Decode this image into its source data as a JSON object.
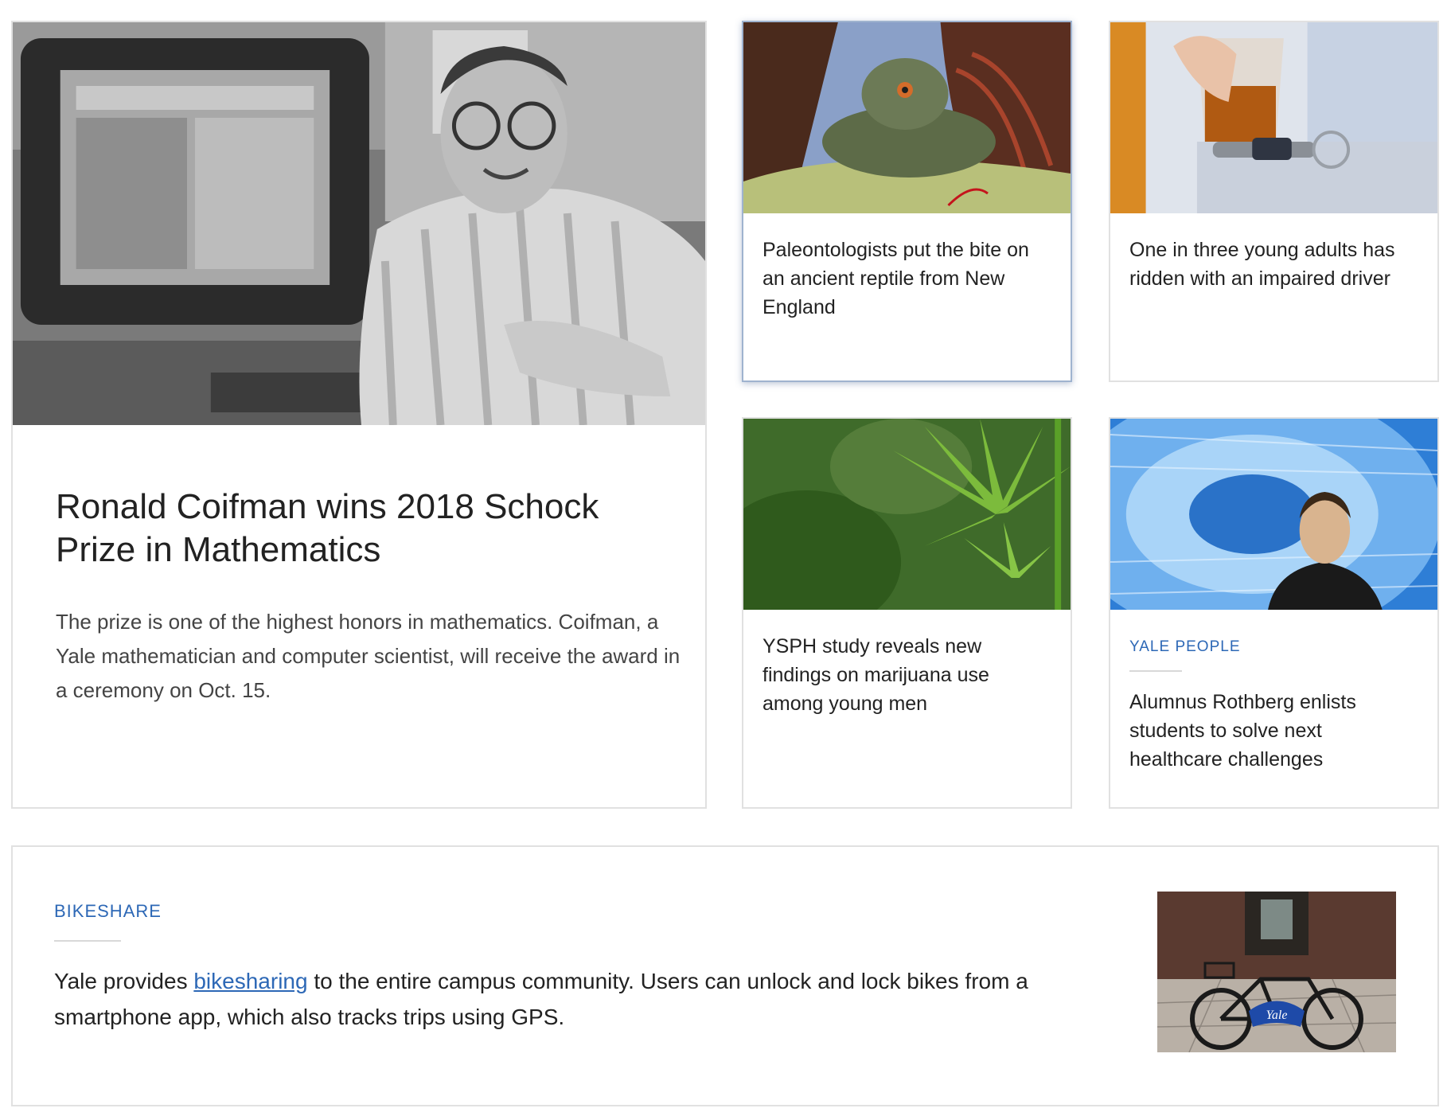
{
  "feature": {
    "image_alt": "Black-and-white photo of a smiling man with glasses seated beside a computer monitor",
    "title": "Ronald Coifman wins 2018 Schock Prize in Mathematics",
    "summary": "The prize is one of the highest honors in mathematics. Coifman, a Yale mathematician and computer scientist, will receive the award in a ceremony on Oct. 15."
  },
  "cards": [
    {
      "image_alt": "Illustration of an ancient reptile in a red and green landscape",
      "title": "Paleontologists put the bite on an ancient reptile from New England"
    },
    {
      "image_alt": "Hand holding a glass of liquor next to car keys",
      "title": "One in three young adults has ridden with an impaired driver"
    },
    {
      "image_alt": "Close-up of green cannabis leaves",
      "title": "YSPH study reveals new findings on marijuana use among young men"
    },
    {
      "image_alt": "Man in front of a blue tunnel of binary digits",
      "kicker": "YALE PEOPLE",
      "title": "Alumnus Rothberg enlists students to solve next healthcare challenges"
    }
  ],
  "banner": {
    "kicker": "BIKESHARE",
    "text_before": "Yale provides ",
    "link_text": "bikesharing",
    "text_after": " to the entire campus community. Users can unlock and lock bikes from a smartphone app, which also tracks trips using GPS.",
    "image_alt": "Blue Yale bike parked in a stone archway",
    "bike_label": "Yale"
  },
  "colors": {
    "accent": "#2d68b6",
    "border": "#e1e1e1",
    "text": "#222222"
  }
}
